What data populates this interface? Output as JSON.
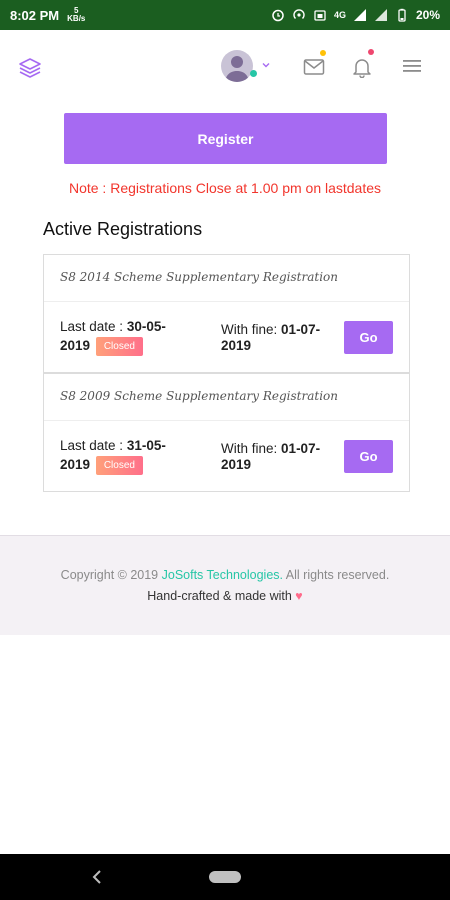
{
  "status_bar": {
    "time": "8:02 PM",
    "speed_value": "5",
    "speed_unit": "KB/s",
    "network": "4G",
    "battery": "20%"
  },
  "header": {
    "logo_icon": "layers-icon",
    "avatar_icon": "user-avatar",
    "mail_icon": "mail-icon",
    "bell_icon": "bell-icon",
    "menu_icon": "hamburger-menu-icon",
    "colors": {
      "accent": "#a66af2",
      "mail_dot": "#ffc107",
      "bell_dot": "#ef476f",
      "online_dot": "#26c6a6"
    }
  },
  "register_label": "Register",
  "note": "Note : Registrations Close at 1.00 pm on lastdates",
  "section_title": "Active Registrations",
  "registrations": [
    {
      "title": "S8 2014 Scheme Supplementary Registration",
      "last_date_label": "Last date :",
      "last_date": "30-05-2019",
      "status": "Closed",
      "with_fine_label": "With fine:",
      "with_fine_date": "01-07-2019",
      "action": "Go"
    },
    {
      "title": "S8 2009 Scheme Supplementary Registration",
      "last_date_label": "Last date :",
      "last_date": "31-05-2019",
      "status": "Closed",
      "with_fine_label": "With fine:",
      "with_fine_date": "01-07-2019",
      "action": "Go"
    }
  ],
  "footer": {
    "copyright_prefix": "Copyright © 2019",
    "company": "JoSofts Technologies.",
    "copyright_suffix": "All rights reserved.",
    "handcrafted": "Hand-crafted & made with",
    "heart": "♥"
  },
  "nav": {
    "back_icon": "back-icon",
    "home_icon": "home-pill-icon"
  }
}
